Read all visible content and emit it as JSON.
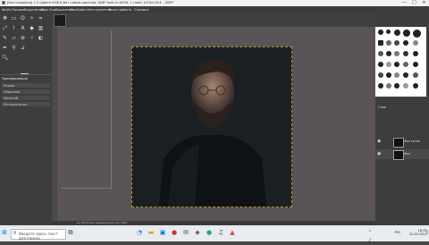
{
  "window": {
    "title": "[Без названия]-7.0 (Цвета RGB 8-бит гамма-цветное, GIMP built-in sRGB, 1 слой) 1024x1024 – GIMP",
    "controls": [
      "—",
      "□",
      "✕"
    ]
  },
  "menu": [
    "Файл",
    "Правка",
    "Выделение",
    "Вид",
    "Изображение",
    "Слой",
    "Цвет",
    "Инструменты",
    "Фильтры",
    "Окна",
    "Справка"
  ],
  "tool_options": {
    "title": "Трансформация",
    "rows": [
      "Режим",
      "Обратный",
      "Масштаб",
      "Интерполяция"
    ]
  },
  "status": {
    "text": "px 100% Без названия.jpg (23,3 МБ)"
  },
  "layers": {
    "header": "Слои",
    "items": [
      {
        "name": "Фон копия"
      },
      {
        "name": "Фон"
      }
    ]
  },
  "taskbar": {
    "search_placeholder": "Введите здесь текст для поиска",
    "clock_time": "16:33",
    "clock_date": "22.05.2021",
    "lang": "РУС"
  },
  "colors": {
    "canvas_bg": "#5a5459",
    "photo_bg": "#1b2024",
    "selection": "#b59a20"
  }
}
